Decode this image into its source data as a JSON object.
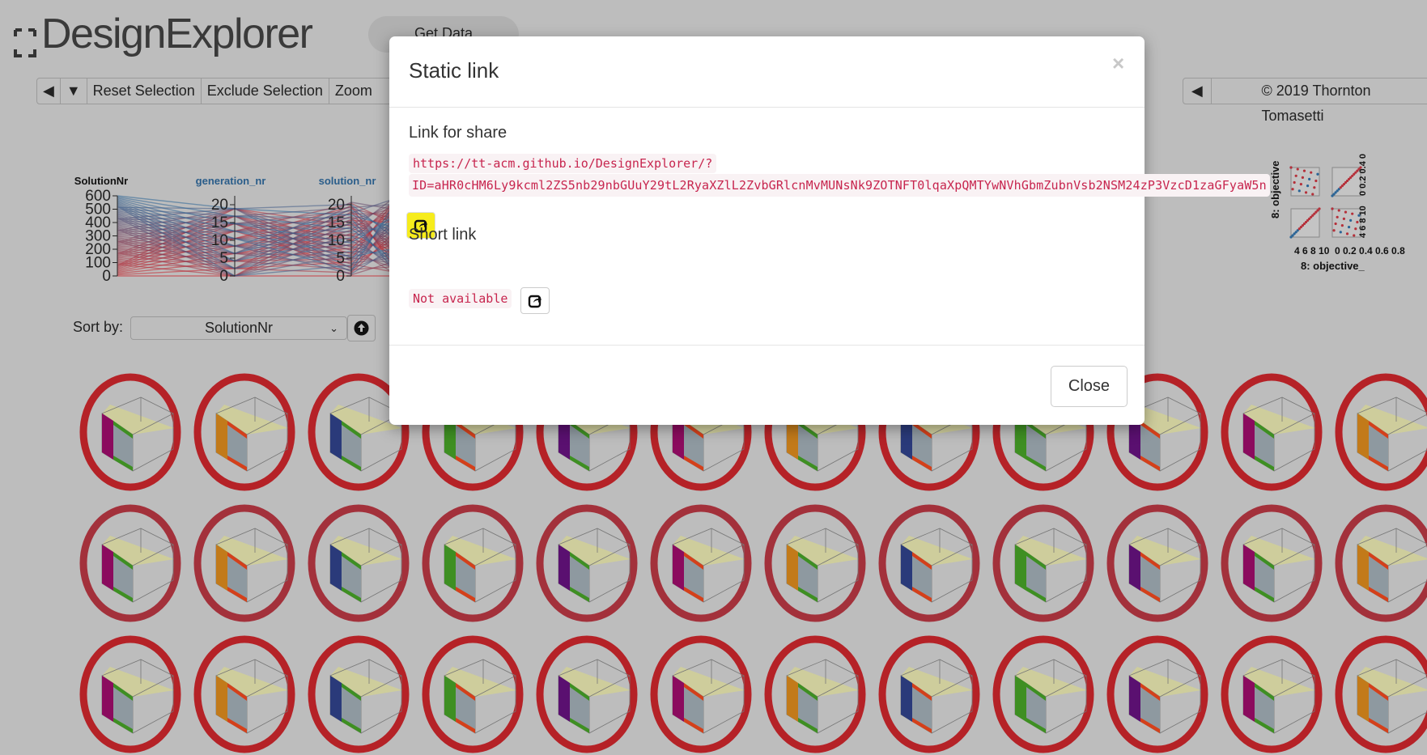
{
  "app": {
    "logo_text": "DesignExplorer",
    "get_data_label": "Get Data"
  },
  "toolbar": {
    "reset_label": "Reset Selection",
    "exclude_label": "Exclude Selection",
    "zoom_label": "Zoom"
  },
  "footer": {
    "copyright": "© 2019 Thornton Tomasetti"
  },
  "parallel": {
    "axes": [
      {
        "label": "SolutionNr",
        "ticks": [
          "0",
          "100",
          "200",
          "300",
          "400",
          "500",
          "600"
        ]
      },
      {
        "label": "generation_nr",
        "ticks": [
          "0",
          "5",
          "10",
          "15",
          "20"
        ]
      },
      {
        "label": "solution_nr",
        "ticks": [
          "0",
          "5",
          "10",
          "15",
          "20"
        ]
      }
    ],
    "colors": {
      "low": "#c8242b",
      "high": "#2a6496"
    }
  },
  "sort": {
    "label": "Sort by:",
    "value": "SolutionNr"
  },
  "scatter": {
    "x_ticks_1": "4 6 8 10",
    "x_ticks_2": "0 0.2 0.4 0.6 0.8",
    "y_ticks_1": "0 0.2 0.4 0.6 0.8",
    "y_ticks_2": "4 6 8 10",
    "x_label": "8: objective_",
    "y_label": "8: objective"
  },
  "modal": {
    "title": "Static link",
    "close_x": "×",
    "share_heading": "Link for share",
    "share_url_line1": "https://tt-acm.github.io/DesignExplorer/?",
    "share_url_line2": "ID=aHR0cHM6Ly9kcml2ZS5nb29nbGUuY29tL2RyaXZlL2ZvbGRlcnMvMUNsNk9ZOTNFT0lqaXpQMTYwNVhGbmZubnVsb2NSM24zP3VzcD1zaGFyaW5n",
    "short_heading": "Short link",
    "short_value": "Not available",
    "close_label": "Close"
  },
  "thumbnails": {
    "ring_colors": [
      "#b52227",
      "#a3313b"
    ],
    "panel_colors": [
      "#8b0b5e",
      "#2a3a7a",
      "#5a1070",
      "#c27a1a",
      "#3e8f22"
    ]
  }
}
